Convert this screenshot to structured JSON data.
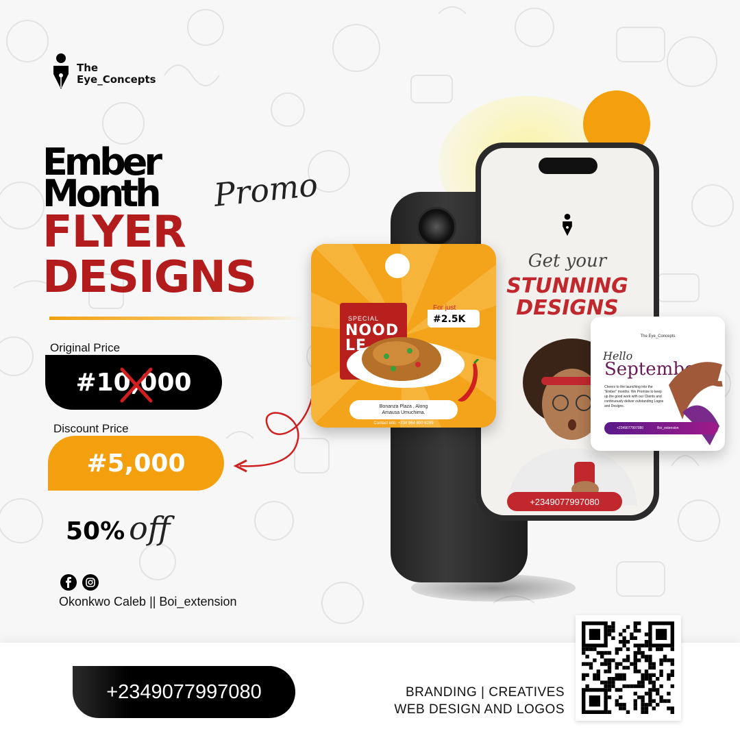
{
  "brand": {
    "line1": "The",
    "line2": "Eye_Concepts"
  },
  "headline": {
    "line1": "Ember",
    "line2": "Month",
    "script": "Promo",
    "line3": "FLYER",
    "line4": "DESIGNS"
  },
  "pricing": {
    "original_label": "Original Price",
    "original_value": "#10,000",
    "discount_label": "Discount Price",
    "discount_value": "#5,000",
    "off_percent": "50%",
    "off_word": "off"
  },
  "social": {
    "handle": "Okonkwo Caleb || Boi_extension",
    "icons": [
      "facebook-icon",
      "instagram-icon"
    ]
  },
  "footer": {
    "phone": "+2349077997080",
    "services_line1": "BRANDING | CREATIVES",
    "services_line2": "WEB DESIGN AND LOGOS"
  },
  "phone_screen": {
    "script": "Get your",
    "line1": "STUNNING",
    "line2": "DESIGNS",
    "phone": "+2349077997080"
  },
  "food_card": {
    "special": "SPECIAL",
    "title_line1": "NOOD",
    "title_line2": "LE",
    "price_label": "For just",
    "price": "#2.5K",
    "address_line1": "Bonanza Plaza , Along",
    "address_line2": "Amausa Umuchima.",
    "contact": "Contact info: +234 964 890 6289"
  },
  "sept_card": {
    "brand": "The Eye_Concepts",
    "script": "Hello",
    "title": "Septembe",
    "body": "Cheers to the launching into the \"Ember\" months. We Promise to keep up the good work with our Clients and continuously deliver outstanding Logos and Designs.",
    "contact_phone": "+2349077997080",
    "contact_handle": "Boi_extension"
  },
  "colors": {
    "accent_orange": "#f4a00e",
    "accent_red": "#b31c1c",
    "dark": "#000000"
  }
}
